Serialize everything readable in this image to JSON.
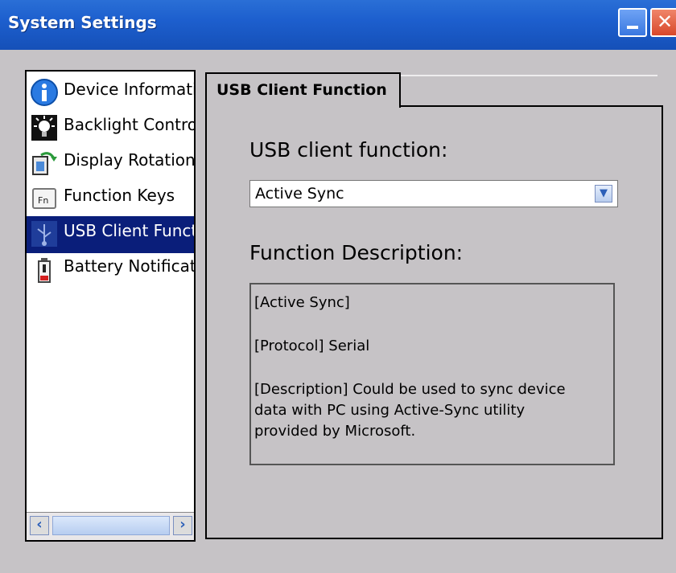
{
  "window": {
    "title": "System Settings"
  },
  "sidebar": {
    "items": [
      {
        "label": "Device Informati",
        "icon": "info-icon"
      },
      {
        "label": "Backlight Contro",
        "icon": "backlight-icon"
      },
      {
        "label": "Display Rotation",
        "icon": "display-rotation-icon"
      },
      {
        "label": "Function Keys",
        "icon": "function-keys-icon"
      },
      {
        "label": "USB Client Funct",
        "icon": "usb-icon",
        "selected": true
      },
      {
        "label": "Battery Notificati",
        "icon": "battery-icon"
      }
    ]
  },
  "tab": {
    "label": "USB Client Function"
  },
  "usb_function": {
    "label": "USB client function:",
    "selected_value": "Active Sync"
  },
  "description": {
    "label": "Function Description:",
    "lines": [
      "[Active Sync]",
      "[Protocol] Serial",
      "[Description] Could be used to sync device",
      "data with PC using Active-Sync utility",
      "provided by Microsoft."
    ]
  },
  "colors": {
    "titlebar": "#1d5fce",
    "selection": "#0a1e7a",
    "background": "#c6c3c6"
  }
}
